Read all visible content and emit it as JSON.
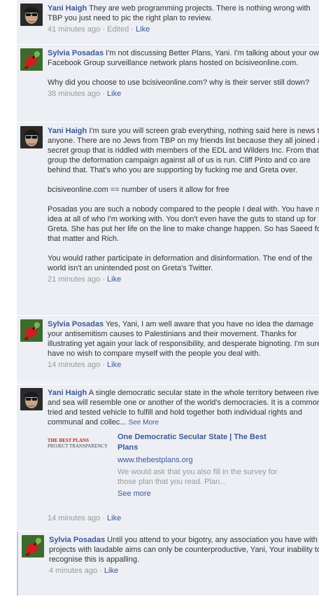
{
  "comments": [
    {
      "author": "Yani Haigh",
      "paragraphs": [
        "They are web programming projects. There is nothing wrong with TBP you just need to pic the right plan to review."
      ],
      "time": "41 minutes ago",
      "edited": "Edited",
      "like": "Like"
    },
    {
      "author": "Sylvia Posadas",
      "paragraphs": [
        "I'm not discussing Better Plans, Yani. I'm talking about your own Facebook Group surveillance network plans hosted on bcisiveonline.com.",
        "Why did you choose to use bcisiveonline.com? why is their server still down?"
      ],
      "time": "38 minutes ago",
      "like": "Like"
    },
    {
      "author": "Yani Haigh",
      "paragraphs": [
        "I'm sure you will screen grab everything, nothing said here is news to anyone. There are no Jews from TBP on my friends list because they all joined a secret group that is riddled with members of the EDL and Wilders Inc. From that group the deformation campaign against all of us is run. Cliff Pinto and co are behind that. That's who you are supporting by fucking me and Greta over.",
        "bcisiveonline.com == number of users it allow for free",
        "Posadas you are such a nobody compared to the people I deal with. You have no idea at all of who I'm working with. You don't even have the guts to stand up for Greta. She has put her life on the line to make change happen. So has Saeed for that matter and Rich.",
        "You would rather participate in deformation and disinformation. The end of the world isn't an unintended post on Greta's Twitter."
      ],
      "time": "21 minutes ago",
      "like": "Like"
    },
    {
      "author": "Sylvia Posadas",
      "paragraphs": [
        "Yes, Yani, I am well aware that you have no idea the damage your antisemitism causes to Palestinians and their movement. Thanks for illustrating yet again your lack of responsibility, and desperate bignoting. I'm sure I have no wish to compare myself with the people you deal with."
      ],
      "time": "14 minutes ago",
      "like": "Like"
    },
    {
      "author": "Yani Haigh",
      "paragraphs": [
        "A single democratic secular state in the whole territory between river and sea will resemble one or another of the world's democracies. It is a common, tried and tested vehicle to fulfill and hold together both individual rights and communal and collec..."
      ],
      "see_more": "See More",
      "link": {
        "thumb_line1": "THE BEST PLANS",
        "thumb_line2": "PROJECT TRANSPARENCY",
        "title": "One Democratic Secular State | The Best Plans",
        "url": "www.thebestplans.org",
        "description": "We would ask that you also fill in the survey for those plan that you read. Plan...",
        "see_more": "See more"
      },
      "time": "14 minutes ago",
      "like": "Like"
    },
    {
      "author": "Sylvia Posadas",
      "paragraphs": [
        "Until you attend to your bigotry, any association you have with projects with laudable aims can only be counterproductive, Yani, Your inability to recognise this is appalling."
      ],
      "time": "4 minutes ago",
      "like": "Like"
    }
  ],
  "separator": "·",
  "colors": {
    "link": "#3b5998",
    "background": "#edeff4",
    "meta": "#999999"
  },
  "avatars": {
    "yani": "sunglasses-face-avatar",
    "sylvia": "red-bird-avatar"
  }
}
